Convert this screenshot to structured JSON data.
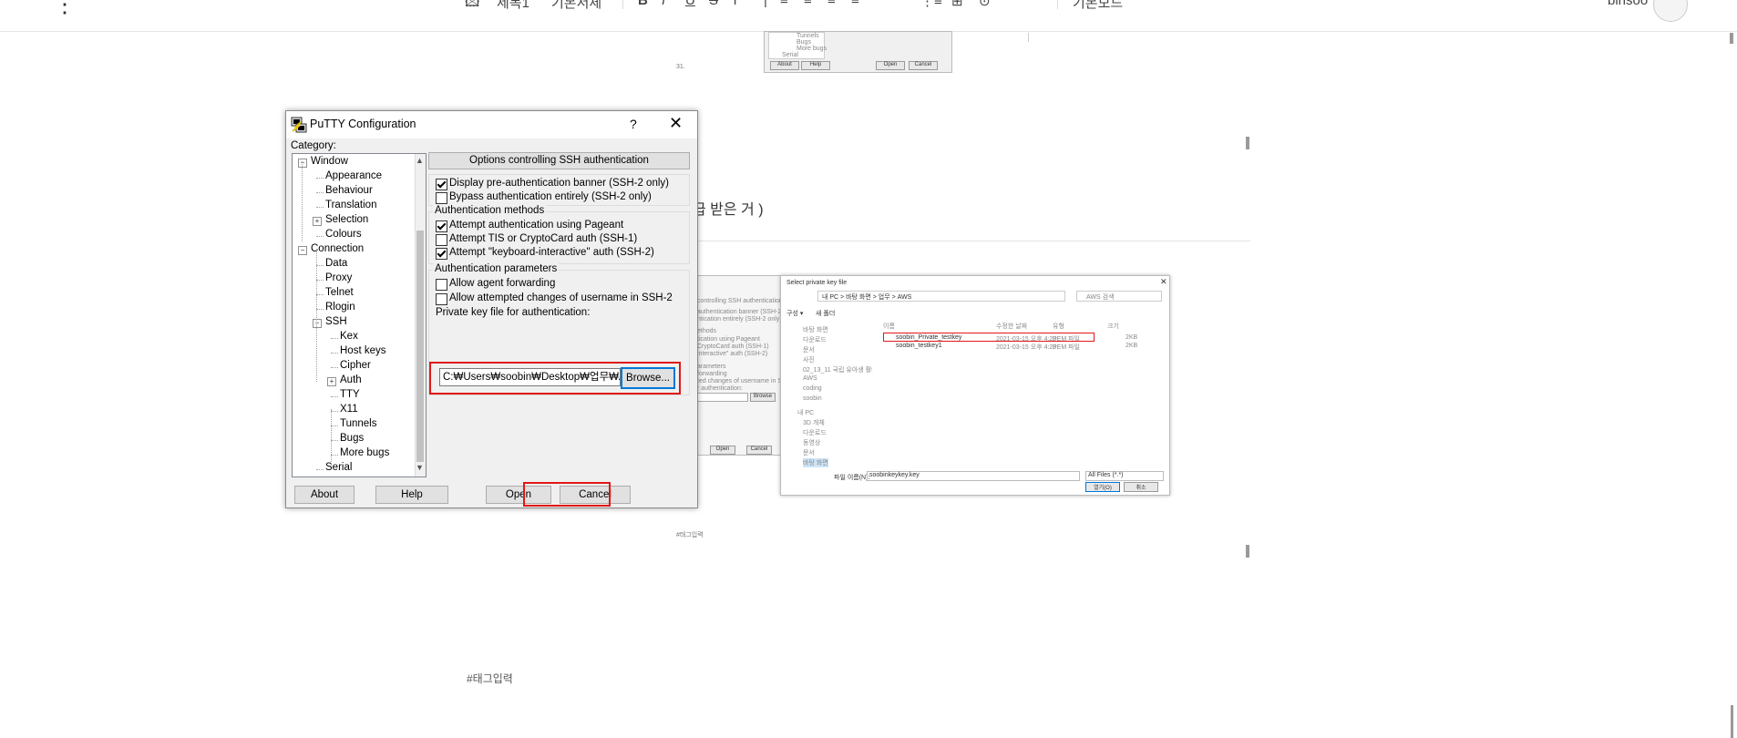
{
  "editor": {
    "toolbar_items": [
      "제목1",
      "기본서체",
      "B",
      "I",
      "U",
      "S",
      "T",
      "|",
      "≡",
      "≡",
      "≡",
      "≡",
      "⋮≡",
      "⊞",
      "⊙",
      "기본모드"
    ],
    "user_name": "binsoo"
  },
  "page": {
    "korean_fragment": "급 받은 거 )",
    "tag_input_placeholder": "#태그입력",
    "caption_top": "31.",
    "caption_mid": "#태그입력"
  },
  "putty": {
    "title": "PuTTY Configuration",
    "help_glyph": "?",
    "close_glyph": "✕",
    "category_label": "Category:",
    "tree": [
      {
        "label": "Window",
        "level": 0,
        "expander": "−"
      },
      {
        "label": "Appearance",
        "level": 1
      },
      {
        "label": "Behaviour",
        "level": 1
      },
      {
        "label": "Translation",
        "level": 1
      },
      {
        "label": "Selection",
        "level": 1,
        "expander": "+"
      },
      {
        "label": "Colours",
        "level": 1
      },
      {
        "label": "Connection",
        "level": 0,
        "expander": "−"
      },
      {
        "label": "Data",
        "level": 1
      },
      {
        "label": "Proxy",
        "level": 1
      },
      {
        "label": "Telnet",
        "level": 1
      },
      {
        "label": "Rlogin",
        "level": 1
      },
      {
        "label": "SSH",
        "level": 1,
        "expander": "−"
      },
      {
        "label": "Kex",
        "level": 2
      },
      {
        "label": "Host keys",
        "level": 2
      },
      {
        "label": "Cipher",
        "level": 2
      },
      {
        "label": "Auth",
        "level": 2,
        "expander": "+"
      },
      {
        "label": "TTY",
        "level": 2
      },
      {
        "label": "X11",
        "level": 2
      },
      {
        "label": "Tunnels",
        "level": 2
      },
      {
        "label": "Bugs",
        "level": 2
      },
      {
        "label": "More bugs",
        "level": 2
      },
      {
        "label": "Serial",
        "level": 1
      }
    ],
    "panel_header": "Options controlling SSH authentication",
    "banner_checks": [
      {
        "label": "Display pre-authentication banner (SSH-2 only)",
        "checked": true
      },
      {
        "label": "Bypass authentication entirely (SSH-2 only)",
        "checked": false
      }
    ],
    "auth_methods_title": "Authentication methods",
    "auth_methods": [
      {
        "label": "Attempt authentication using Pageant",
        "checked": true
      },
      {
        "label": "Attempt TIS or CryptoCard auth (SSH-1)",
        "checked": false
      },
      {
        "label": "Attempt \"keyboard-interactive\" auth (SSH-2)",
        "checked": true
      }
    ],
    "auth_params_title": "Authentication parameters",
    "auth_params": [
      {
        "label": "Allow agent forwarding",
        "checked": false
      },
      {
        "label": "Allow attempted changes of username in SSH-2",
        "checked": false
      }
    ],
    "private_key_label": "Private key file for authentication:",
    "private_key_value": "C:₩Users₩soobin₩Desktop₩업무₩A",
    "browse_label": "Browse...",
    "about_label": "About",
    "help_label": "Help",
    "open_label": "Open",
    "cancel_label": "Cancel"
  },
  "bg_top_shot": {
    "tree_items": [
      "Tunnels",
      "Bugs",
      "More bugs",
      "Serial"
    ],
    "about": "About",
    "help": "Help",
    "open": "Open",
    "cancel": "Cancel"
  },
  "file_dialog": {
    "title": "Select private key file",
    "path": "내 PC  >  바탕 화면  >  업무  >  AWS",
    "search_placeholder": "AWS 검색",
    "toolbar": [
      "구성 ▾",
      "새 폴더"
    ],
    "columns": [
      "이름",
      "수정한 날짜",
      "유형",
      "크기"
    ],
    "files": [
      {
        "name": "soobin_Private_testkey",
        "date": "2021-03-15 오후 4:20",
        "type": "PEM 파일",
        "size": "2KB"
      },
      {
        "name": "soobin_testkey1",
        "date": "2021-03-15 오후 4:29",
        "type": "PEM 파일",
        "size": "2KB"
      }
    ],
    "nav_items": [
      "바탕 화면",
      "다운로드",
      "문서",
      "사진",
      "02_13_11 국립 유아생 활태스 관",
      "AWS",
      "coding",
      "soobin",
      "내 PC",
      "3D 개체",
      "다운로드",
      "동영상",
      "문서",
      "바탕 화면"
    ],
    "filename_label": "파일 이름(N):",
    "filename_value": "soobinkeykey.key",
    "filter_value": "All Files (*.*)",
    "open_btn": "열기(O)",
    "cancel_btn": "취소",
    "bg_left_lines": [
      "controlling SSH authentication",
      "authentication banner (SSH-2 only)",
      "ntication entirely (SSH-2 only)",
      "ethods",
      "tication using Pageant",
      "CryptoCard auth (SSH-1)",
      "interactive\" auth (SSH-2)",
      "arameters",
      "forwarding",
      "ted changes of username in SSH-2",
      "r authentication:"
    ],
    "bg_open": "Open",
    "bg_cancel": "Cancel",
    "bg_browse": "Browse"
  }
}
